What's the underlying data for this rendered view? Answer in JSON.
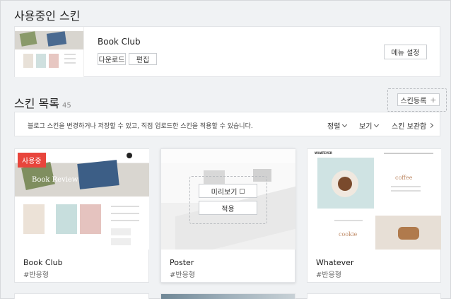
{
  "current": {
    "title": "사용중인 스킨",
    "skin_name": "Book Club",
    "download_label": "다운로드",
    "edit_label": "편집",
    "menu_settings_label": "메뉴 설정"
  },
  "list": {
    "title": "스킨 목록",
    "count": "45",
    "register_label": "스킨등록",
    "register_icon": "+",
    "description": "블로그 스킨을 변경하거나 저장할 수 있고, 직접 업로드한 스킨을 적용할 수 있습니다.",
    "filters": {
      "sort": "정렬",
      "view": "보기",
      "storage": "스킨 보관함"
    }
  },
  "cards": [
    {
      "name": "Book Club",
      "tag": "#반응형",
      "badge": "사용중",
      "banner_text": "Book Review"
    },
    {
      "name": "Poster",
      "tag": "#반응형",
      "preview_label": "미리보기",
      "apply_label": "적용"
    },
    {
      "name": "Whatever",
      "tag": "#반응형",
      "header_text": "WHATEVER",
      "coffee_text": "coffee",
      "cookie_text": "cookie"
    }
  ],
  "colors": {
    "badge_red": "#e8453c",
    "page_bg": "#f0f2f4",
    "border": "#e2e4e7"
  }
}
